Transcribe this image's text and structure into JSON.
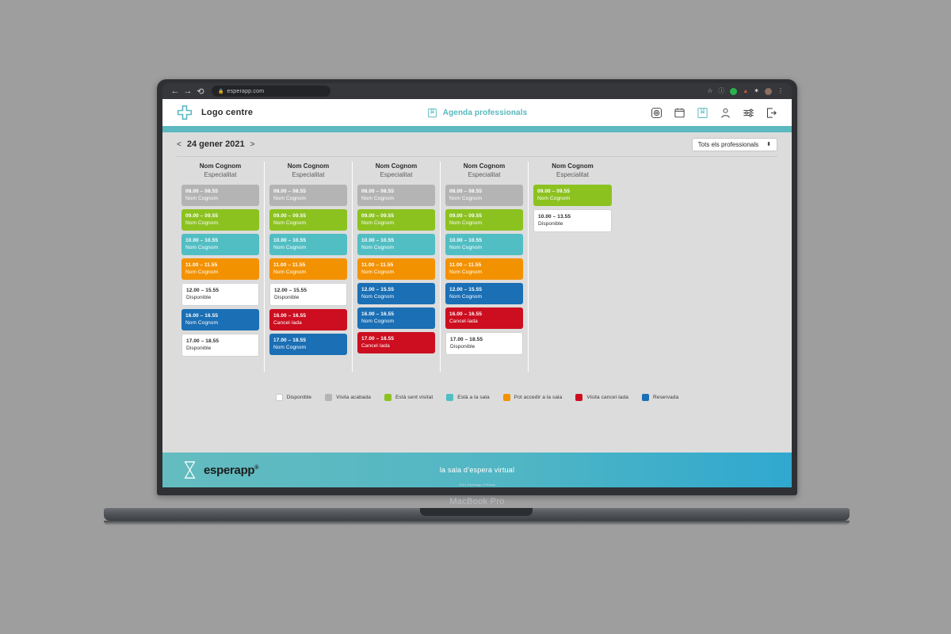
{
  "device": {
    "model_label": "MacBook Pro"
  },
  "browser": {
    "back_icon": "back-arrow-icon",
    "forward_icon": "forward-arrow-icon",
    "reload_icon": "reload-icon",
    "lock_icon": "lock-icon",
    "url": "esperapp.com",
    "extensions": [
      {
        "name": "bookmark-star-icon",
        "glyph": "☆",
        "color": "#c8cbcf"
      },
      {
        "name": "info-circle-icon",
        "glyph": "ⓘ",
        "color": "#9aa0a6"
      },
      {
        "name": "extension-green-dot-icon",
        "glyph": "",
        "color": "#2bb24c"
      },
      {
        "name": "extension-red-triangle-icon",
        "glyph": "▲",
        "color": "#e8542f"
      },
      {
        "name": "extension-puzzle-icon",
        "glyph": "✦",
        "color": "#e8eaed"
      },
      {
        "name": "profile-avatar-icon",
        "glyph": "",
        "color": "#8d6e63"
      },
      {
        "name": "chrome-menu-icon",
        "glyph": "⋮",
        "color": "#c8cbcf"
      }
    ]
  },
  "header": {
    "logo_icon": "medical-cross-icon",
    "logo_label": "Logo centre",
    "agenda_icon": "agenda-book-icon",
    "agenda_title": "Agenda professionals",
    "icons": [
      {
        "name": "camera-icon"
      },
      {
        "name": "calendar-icon"
      },
      {
        "name": "agenda-book-icon"
      },
      {
        "name": "user-icon"
      },
      {
        "name": "settings-sliders-icon"
      },
      {
        "name": "logout-icon"
      }
    ]
  },
  "toolbar": {
    "prev_arrow": "<",
    "date_label": "24 gener 2021",
    "next_arrow": ">",
    "professional_filter": {
      "value": "Tots els professionals",
      "caret_icon": "updown-caret-icon"
    }
  },
  "agenda": {
    "columns": [
      {
        "name": "Nom Cognom",
        "specialty": "Especialitat",
        "appointments": [
          {
            "time": "08.00 – 08.55",
            "label": "Nom Cognom",
            "status": "acabada"
          },
          {
            "time": "09.00 – 09.55",
            "label": "Nom Cognom",
            "status": "visitant"
          },
          {
            "time": "10.00 – 10.55",
            "label": "Nom Cognom",
            "status": "sala"
          },
          {
            "time": "11.00 – 11.55",
            "label": "Nom Cognom",
            "status": "accedir"
          },
          {
            "time": "12.00 – 15.55",
            "label": "Disponible",
            "status": "disponible"
          },
          {
            "time": "16.00 – 16.55",
            "label": "Nom Cognom",
            "status": "reservada"
          },
          {
            "time": "17.00 – 18.55",
            "label": "Disponible",
            "status": "disponible"
          }
        ]
      },
      {
        "name": "Nom Cognom",
        "specialty": "Especialitat",
        "appointments": [
          {
            "time": "08.00 – 08.55",
            "label": "Nom Cognom",
            "status": "acabada"
          },
          {
            "time": "09.00 – 09.55",
            "label": "Nom Cognom",
            "status": "visitant"
          },
          {
            "time": "10.00 – 10.55",
            "label": "Nom Cognom",
            "status": "sala"
          },
          {
            "time": "11.00 – 11.55",
            "label": "Nom Cognom",
            "status": "accedir"
          },
          {
            "time": "12.00 – 15.55",
            "label": "Disponible",
            "status": "disponible"
          },
          {
            "time": "16.00 – 16.55",
            "label": "Cancel·lada",
            "status": "cancelada"
          },
          {
            "time": "17.00 – 18.55",
            "label": "Nom Cognom",
            "status": "reservada"
          }
        ]
      },
      {
        "name": "Nom Cognom",
        "specialty": "Especialitat",
        "appointments": [
          {
            "time": "08.00 – 08.55",
            "label": "Nom Cognom",
            "status": "acabada"
          },
          {
            "time": "09.00 – 09.55",
            "label": "Nom Cognom",
            "status": "visitant"
          },
          {
            "time": "10.00 – 10.55",
            "label": "Nom Cognom",
            "status": "sala"
          },
          {
            "time": "11.00 – 11.55",
            "label": "Nom Cognom",
            "status": "accedir"
          },
          {
            "time": "12.00 – 15.55",
            "label": "Nom Cognom",
            "status": "reservada"
          },
          {
            "time": "16.00 – 16.55",
            "label": "Nom Cognom",
            "status": "reservada"
          },
          {
            "time": "17.00 – 18.55",
            "label": "Cancel·lada",
            "status": "cancelada"
          }
        ]
      },
      {
        "name": "Nom Cognom",
        "specialty": "Especialitat",
        "appointments": [
          {
            "time": "08.00 – 08.55",
            "label": "Nom Cognom",
            "status": "acabada"
          },
          {
            "time": "09.00 – 09.55",
            "label": "Nom Cognom",
            "status": "visitant"
          },
          {
            "time": "10.00 – 10.55",
            "label": "Nom Cognom",
            "status": "sala"
          },
          {
            "time": "11.00 – 11.55",
            "label": "Nom Cognom",
            "status": "accedir"
          },
          {
            "time": "12.00 – 15.55",
            "label": "Nom Cognom",
            "status": "reservada"
          },
          {
            "time": "16.00 – 16.55",
            "label": "Cancel·lada",
            "status": "cancelada"
          },
          {
            "time": "17.00 – 18.55",
            "label": "Disponible",
            "status": "disponible"
          }
        ]
      },
      {
        "name": "Nom Cognom",
        "specialty": "Especialitat",
        "appointments": [
          {
            "time": "09.00 – 09.55",
            "label": "Nom Cognom",
            "status": "visitant"
          },
          {
            "time": "10.00 – 13.55",
            "label": "Disponible",
            "status": "disponible"
          }
        ]
      }
    ]
  },
  "legend": {
    "items": [
      {
        "label": "Disponible",
        "color": "#ffffff",
        "status": "disponible"
      },
      {
        "label": "Visita acabada",
        "color": "#b4b4b4",
        "status": "acabada"
      },
      {
        "label": "Està sent visitat",
        "color": "#8cc220",
        "status": "visitant"
      },
      {
        "label": "Està a la sala",
        "color": "#51bec4",
        "status": "sala"
      },
      {
        "label": "Pot accedir a la sala",
        "color": "#f39200",
        "status": "accedir"
      },
      {
        "label": "Visita cancel·lada",
        "color": "#cc0e20",
        "status": "cancelada"
      },
      {
        "label": "Reservada",
        "color": "#1a6fb5",
        "status": "reservada"
      }
    ]
  },
  "footer": {
    "logo_icon": "hourglass-icon",
    "wordmark": "esperapp",
    "trademark": "®",
    "tagline": "la sala d’espera virtual",
    "copyright": "2021 Esperapp | Privacy"
  },
  "theme": {
    "teal": "#5bb9bf",
    "page_bg": "#dcdcdc",
    "desktop_bg": "#9e9e9e"
  }
}
